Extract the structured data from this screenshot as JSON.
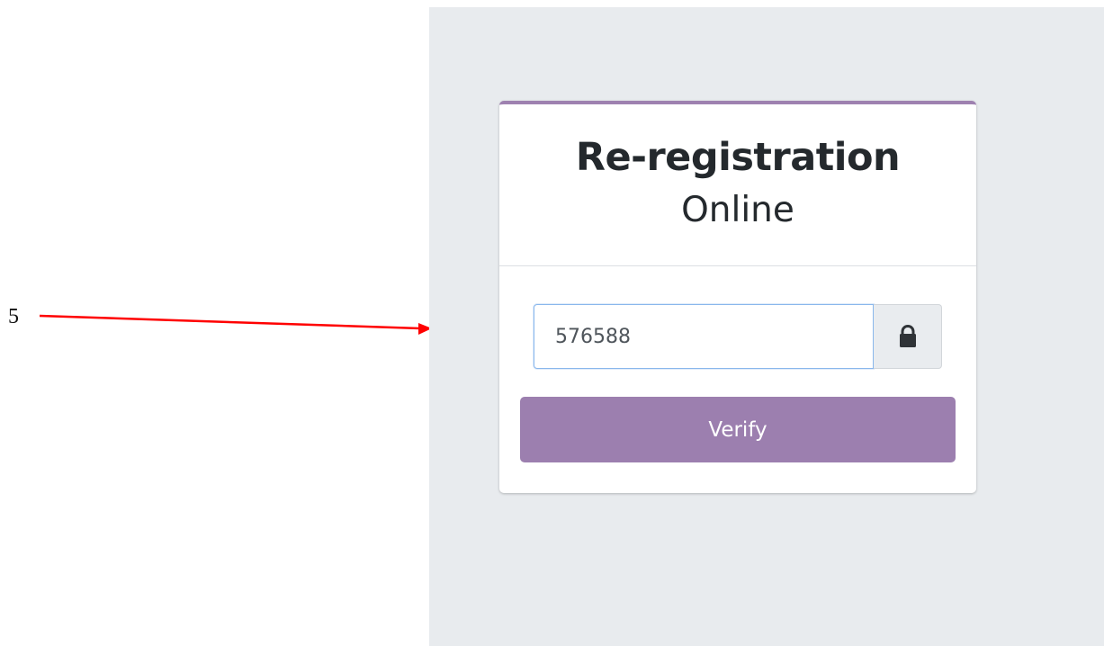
{
  "annotation": {
    "number_label": "5"
  },
  "colors": {
    "background_panel": "#e8ebee",
    "accent_purple": "#9c7faf",
    "arrow_red": "#ff0000",
    "input_border_focus": "#8ab7ec"
  },
  "form": {
    "title": "Re-registration",
    "subtitle": "Online",
    "code_value": "576588",
    "lock_icon": "lock-icon",
    "verify_label": "Verify"
  }
}
